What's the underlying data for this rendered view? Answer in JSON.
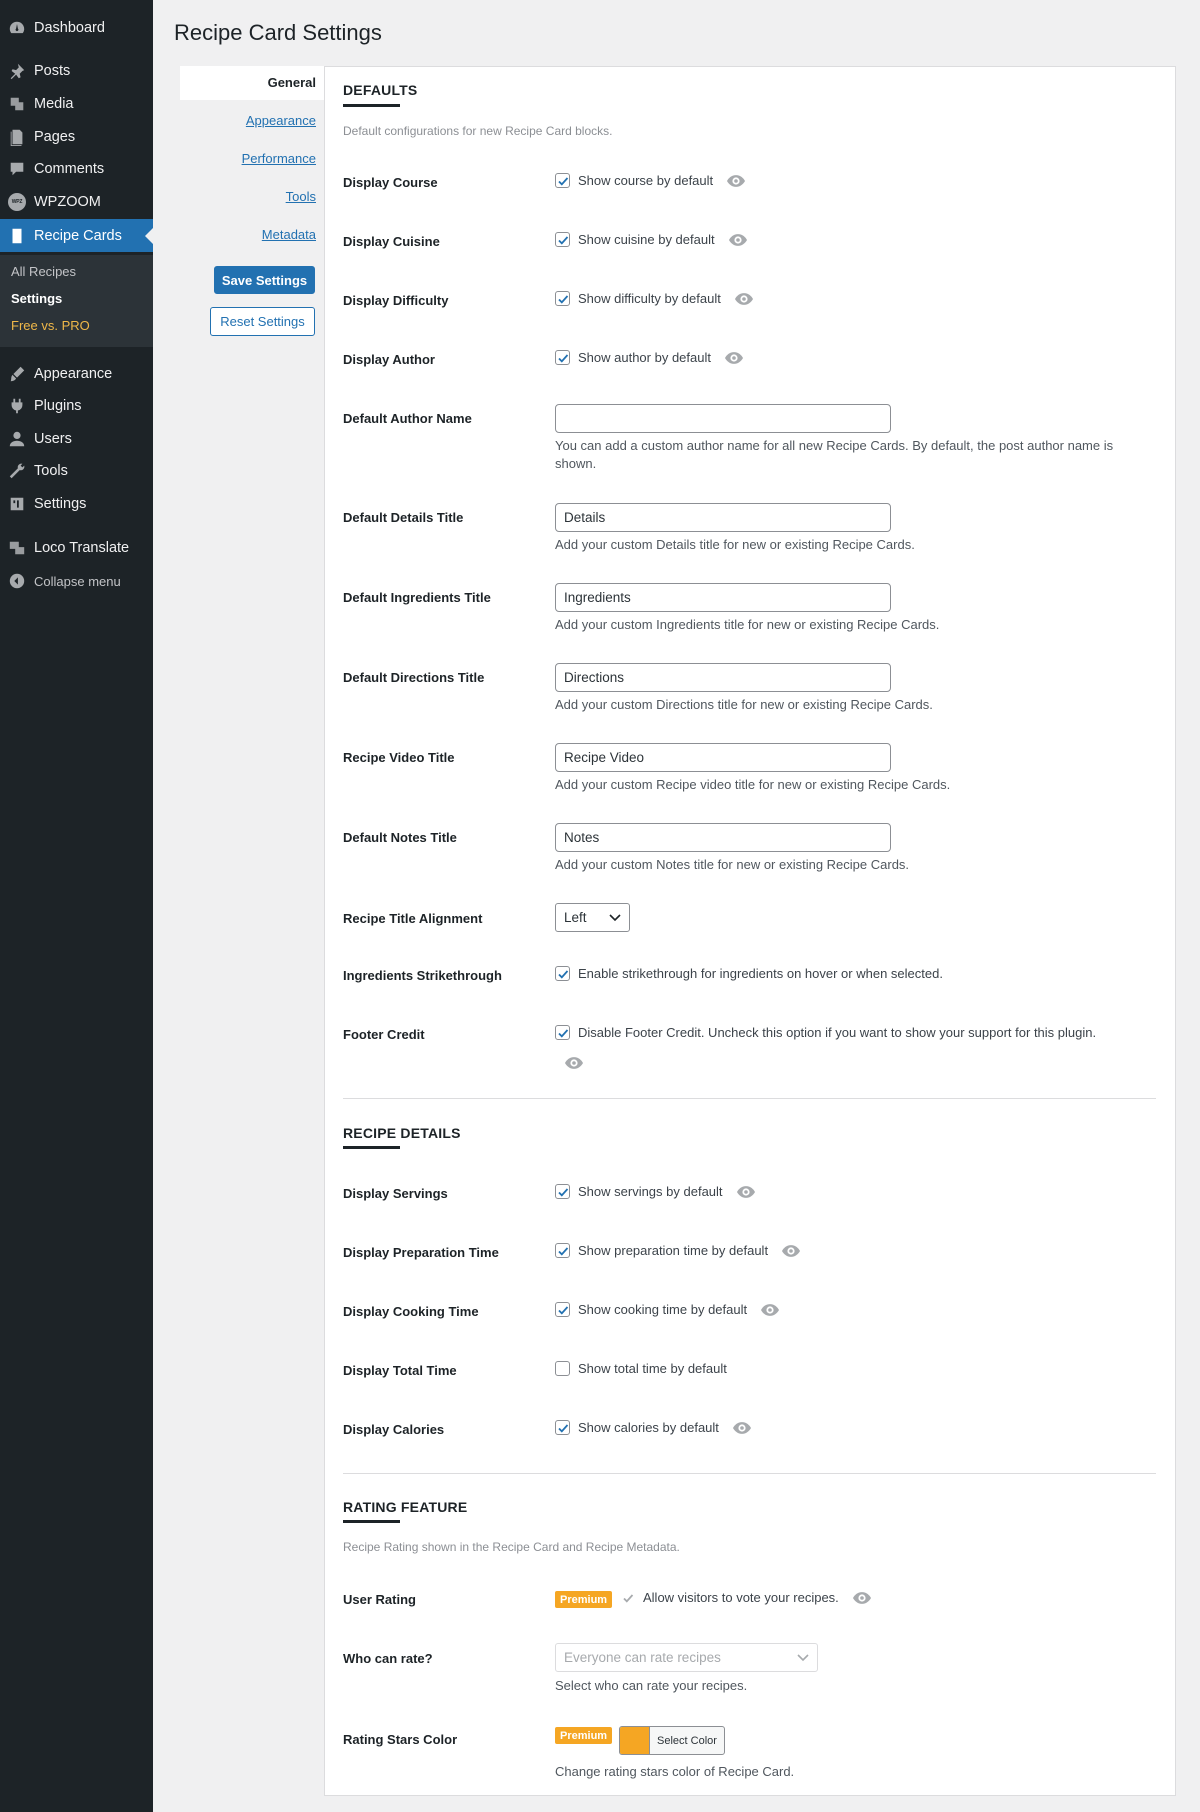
{
  "sidebar": {
    "items": [
      {
        "label": "Dashboard",
        "icon": "dashboard-icon"
      },
      {
        "label": "Posts",
        "icon": "pin-icon"
      },
      {
        "label": "Media",
        "icon": "media-icon"
      },
      {
        "label": "Pages",
        "icon": "pages-icon"
      },
      {
        "label": "Comments",
        "icon": "comment-icon"
      },
      {
        "label": "WPZOOM",
        "icon": "wpzoom-icon",
        "badge": "WPZ"
      },
      {
        "label": "Recipe Cards",
        "icon": "recipe-icon",
        "current": true
      },
      {
        "label": "Appearance",
        "icon": "brush-icon"
      },
      {
        "label": "Plugins",
        "icon": "plug-icon"
      },
      {
        "label": "Users",
        "icon": "user-icon"
      },
      {
        "label": "Tools",
        "icon": "wrench-icon"
      },
      {
        "label": "Settings",
        "icon": "settings-icon"
      },
      {
        "label": "Loco Translate",
        "icon": "translate-icon"
      },
      {
        "label": "Collapse menu",
        "icon": "collapse-icon"
      }
    ],
    "submenu": {
      "all_recipes": "All Recipes",
      "settings": "Settings",
      "free_vs_pro": "Free vs. PRO"
    }
  },
  "page": {
    "title": "Recipe Card Settings"
  },
  "tabs": {
    "general": "General",
    "appearance": "Appearance",
    "performance": "Performance",
    "tools": "Tools",
    "metadata": "Metadata"
  },
  "actions": {
    "save": "Save Settings",
    "reset": "Reset Settings"
  },
  "defaults": {
    "title": "DEFAULTS",
    "description": "Default configurations for new Recipe Card blocks.",
    "course": {
      "label": "Display Course",
      "option": "Show course by default",
      "checked": true
    },
    "cuisine": {
      "label": "Display Cuisine",
      "option": "Show cuisine by default",
      "checked": true
    },
    "difficulty": {
      "label": "Display Difficulty",
      "option": "Show difficulty by default",
      "checked": true
    },
    "author": {
      "label": "Display Author",
      "option": "Show author by default",
      "checked": true
    },
    "author_name": {
      "label": "Default Author Name",
      "value": "",
      "help": "You can add a custom author name for all new Recipe Cards. By default, the post author name is shown."
    },
    "details_title": {
      "label": "Default Details Title",
      "value": "Details",
      "help": "Add your custom Details title for new or existing Recipe Cards."
    },
    "ingredients_title": {
      "label": "Default Ingredients Title",
      "value": "Ingredients",
      "help": "Add your custom Ingredients title for new or existing Recipe Cards."
    },
    "directions_title": {
      "label": "Default Directions Title",
      "value": "Directions",
      "help": "Add your custom Directions title for new or existing Recipe Cards."
    },
    "video_title": {
      "label": "Recipe Video Title",
      "value": "Recipe Video",
      "help": "Add your custom Recipe video title for new or existing Recipe Cards."
    },
    "notes_title": {
      "label": "Default Notes Title",
      "value": "Notes",
      "help": "Add your custom Notes title for new or existing Recipe Cards."
    },
    "title_alignment": {
      "label": "Recipe Title Alignment",
      "value": "Left"
    },
    "strikethrough": {
      "label": "Ingredients Strikethrough",
      "option": "Enable strikethrough for ingredients on hover or when selected.",
      "checked": true
    },
    "footer_credit": {
      "label": "Footer Credit",
      "option": "Disable Footer Credit. Uncheck this option if you want to show your support for this plugin.",
      "checked": true
    }
  },
  "recipe_details": {
    "title": "RECIPE DETAILS",
    "servings": {
      "label": "Display Servings",
      "option": "Show servings by default",
      "checked": true
    },
    "prep_time": {
      "label": "Display Preparation Time",
      "option": "Show preparation time by default",
      "checked": true
    },
    "cook_time": {
      "label": "Display Cooking Time",
      "option": "Show cooking time by default",
      "checked": true
    },
    "total_time": {
      "label": "Display Total Time",
      "option": "Show total time by default",
      "checked": false
    },
    "calories": {
      "label": "Display Calories",
      "option": "Show calories by default",
      "checked": true
    }
  },
  "rating": {
    "title": "RATING FEATURE",
    "description": "Recipe Rating shown in the Recipe Card and Recipe Metadata.",
    "premium_label": "Premium",
    "user_rating": {
      "label": "User Rating",
      "option": "Allow visitors to vote your recipes.",
      "checked": true
    },
    "who_can_rate": {
      "label": "Who can rate?",
      "value": "Everyone can rate recipes",
      "help": "Select who can rate your recipes."
    },
    "stars_color": {
      "label": "Rating Stars Color",
      "button": "Select Color",
      "color": "#f5a623",
      "help": "Change rating stars color of Recipe Card."
    }
  },
  "colors": {
    "accent": "#2271b1",
    "sidebar": "#1d2327",
    "premium": "#f5a623"
  }
}
